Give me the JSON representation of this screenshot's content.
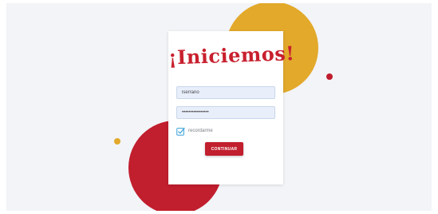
{
  "login": {
    "title": "¡Iniciemos!",
    "username_value": "lserrano",
    "password_value": "••••••••••••••••",
    "remember_label": "recordarme",
    "remember_checked": true,
    "submit_label": "CONTINUAR"
  },
  "colors": {
    "brand_red": "#c11e2e",
    "brand_yellow": "#e2a92b",
    "background": "#f2f4f7",
    "checkbox_accent": "#3aa0d8"
  },
  "icons": {
    "checkbox": "checkbox-checked-icon"
  }
}
